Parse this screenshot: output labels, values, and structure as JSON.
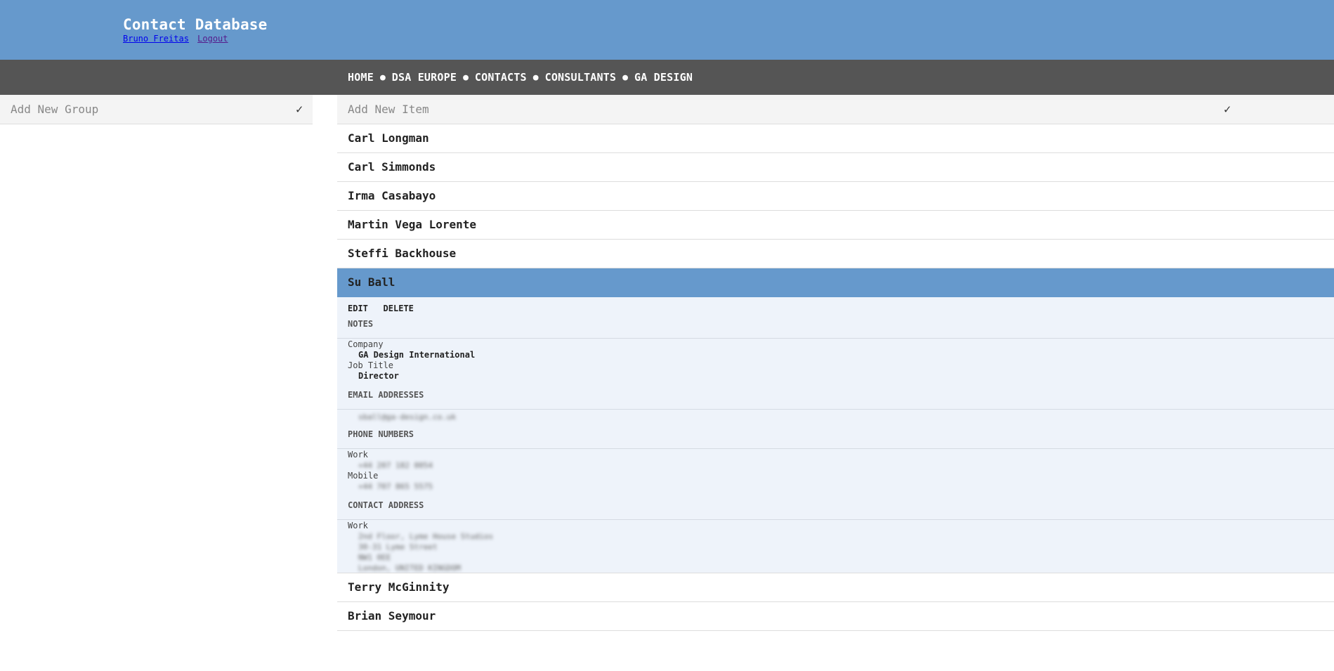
{
  "header": {
    "title": "Contact Database",
    "user_link": "Bruno Freitas",
    "logout_link": "Logout"
  },
  "nav": {
    "items": [
      "HOME",
      "DSA EUROPE",
      "CONTACTS",
      "CONSULTANTS",
      "GA DESIGN"
    ],
    "separator": "●"
  },
  "groups": {
    "add_placeholder": "Add New Group",
    "confirm_icon": "✓"
  },
  "items": {
    "add_placeholder": "Add New Item",
    "confirm_icon": "✓"
  },
  "contacts": [
    {
      "name": "Carl Longman"
    },
    {
      "name": "Carl Simmonds"
    },
    {
      "name": "Irma Casabayo"
    },
    {
      "name": "Martin Vega Lorente"
    },
    {
      "name": "Steffi Backhouse"
    },
    {
      "name": "Su Ball",
      "selected": true
    },
    {
      "name": "Terry McGinnity"
    },
    {
      "name": "Brian Seymour"
    }
  ],
  "detail": {
    "edit_label": "EDIT",
    "delete_label": "DELETE",
    "notes_heading": "NOTES",
    "company_label": "Company",
    "company_value": "GA Design International",
    "job_title_label": "Job Title",
    "job_title_value": "Director",
    "email_heading": "EMAIL ADDRESSES",
    "email_value": "sball@ga-design.co.uk",
    "phone_heading": "PHONE NUMBERS",
    "work_phone_label": "Work",
    "work_phone_value": "+44 207 182 0054",
    "mobile_phone_label": "Mobile",
    "mobile_phone_value": "+44 707 865 5575",
    "address_heading": "CONTACT ADDRESS",
    "address_label": "Work",
    "address_line1": "2nd Floor, Lyme House Studios",
    "address_line2": "30-31 Lyme Street",
    "address_line3": "NW1 0EE",
    "address_line4": "London, UNITED KINGDOM"
  },
  "colors": {
    "header_bg": "#6699cc",
    "nav_bg": "#555555",
    "selected_row_bg": "#6699cc",
    "detail_bg": "#eef3fa"
  }
}
